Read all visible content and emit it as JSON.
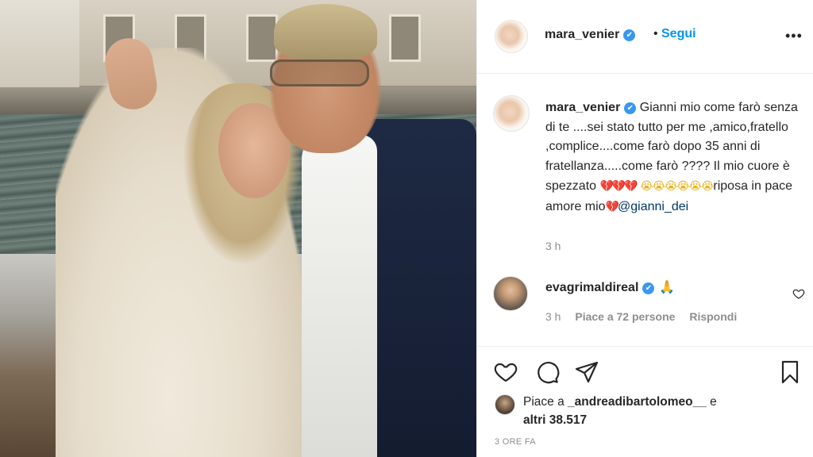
{
  "post": {
    "author": "mara_venier",
    "follow_label": "Segui",
    "separator": "•",
    "more_label": "•••",
    "verified_mark": "✔",
    "caption_prefix": "Gianni mio come farò senza di te ....sei stato tutto per me ,amico,fratello ,complice....come farò dopo 35 anni di fratellanza.....come farò ???? Il mio cuore è spezzato ",
    "caption_hearts": "💔💔💔",
    "caption_cries": "😭😭😭😭😭😭",
    "caption_middle": "riposa in pace amore mio",
    "caption_end_heart": "💔",
    "mention": "@gianni_dei",
    "time": "3 h"
  },
  "comment": {
    "author": "evagrimaldireal",
    "emoji": "🙏",
    "time": "3 h",
    "likes": "Piace a 72 persone",
    "reply": "Rispondi"
  },
  "likes": {
    "prefix": "Piace a ",
    "user": "_andreadibartolomeo__",
    "middle": " e",
    "others": "altri 38.517"
  },
  "date": "3 ORE FA",
  "icons": {
    "like": "heart-icon",
    "comment": "comment-bubble-icon",
    "share": "paper-plane-icon",
    "save": "bookmark-icon"
  },
  "colors": {
    "link_blue": "#0095f6",
    "verified_blue": "#3897f0",
    "mention": "#00376b",
    "muted": "#8e8e8e"
  }
}
